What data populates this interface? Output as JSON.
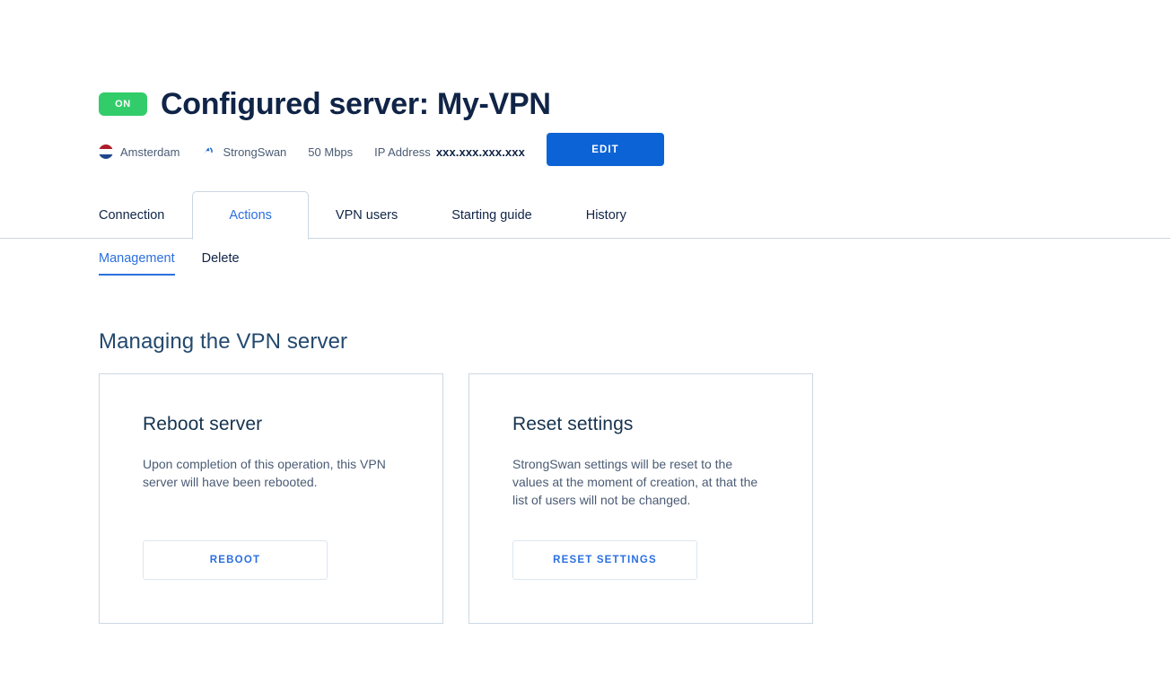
{
  "header": {
    "status_badge": "ON",
    "title": "Configured server: My-VPN"
  },
  "meta": {
    "location": "Amsterdam",
    "location_icon": "netherlands-flag-icon",
    "protocol": "StrongSwan",
    "protocol_icon": "strongswan-logo-icon",
    "bandwidth": "50 Mbps",
    "ip_label": "IP Address",
    "ip_value": "xxx.xxx.xxx.xxx",
    "edit_button": "EDIT"
  },
  "tabs": [
    {
      "label": "Connection",
      "active": false
    },
    {
      "label": "Actions",
      "active": true
    },
    {
      "label": "VPN users",
      "active": false
    },
    {
      "label": "Starting guide",
      "active": false
    },
    {
      "label": "History",
      "active": false
    }
  ],
  "subtabs": [
    {
      "label": "Management",
      "active": true
    },
    {
      "label": "Delete",
      "active": false
    }
  ],
  "section": {
    "title": "Managing the VPN server"
  },
  "cards": [
    {
      "title": "Reboot server",
      "description": "Upon completion of this operation, this VPN server will have been rebooted.",
      "button": "REBOOT"
    },
    {
      "title": "Reset settings",
      "description": "StrongSwan settings will be reset to the values at the moment of creation, at that the list of users will not be changed.",
      "button": "RESET SETTINGS"
    }
  ],
  "colors": {
    "accent_blue": "#2b6fe0",
    "button_blue": "#0b63d6",
    "status_green": "#32cd6a",
    "title_navy": "#102447",
    "border_grey": "#c9d6e2"
  }
}
